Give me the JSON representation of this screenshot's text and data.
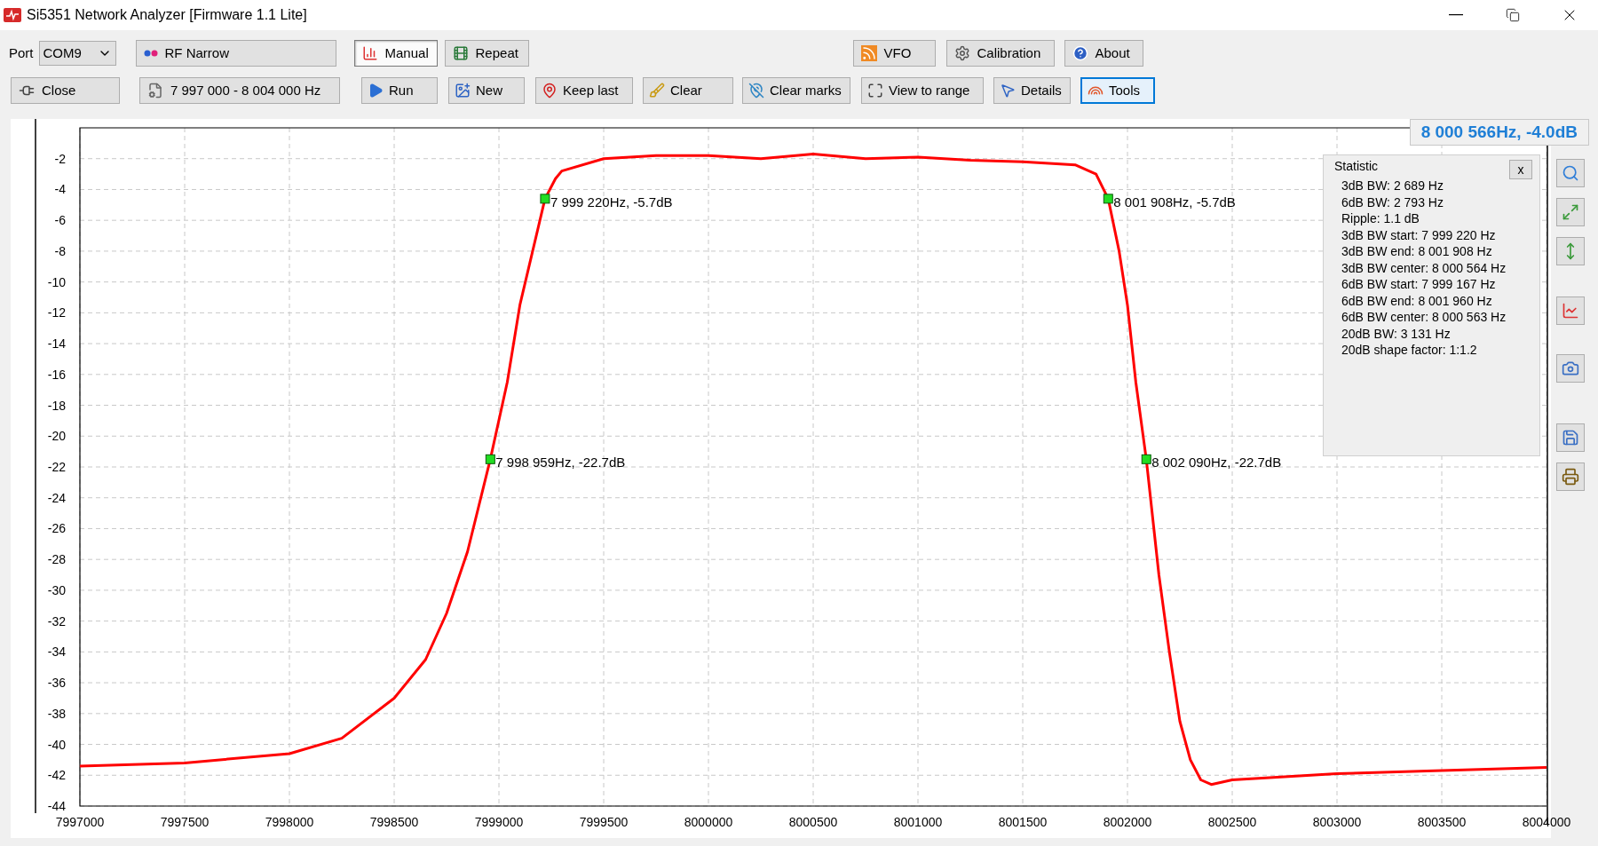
{
  "window": {
    "title": "Si5351 Network Analyzer [Firmware 1.1 Lite]"
  },
  "toolbar": {
    "port_label": "Port",
    "port_value": "COM9",
    "mode": "RF Narrow",
    "range": "7 997 000 - 8 004 000 Hz",
    "close_button": "Close",
    "sweep_modes": [
      {
        "label": "Manual",
        "selected": true
      },
      {
        "label": "Repeat",
        "selected": false
      }
    ],
    "top_buttons": [
      "VFO",
      "Calibration",
      "About"
    ],
    "actions": [
      {
        "label": "Run",
        "focused": false
      },
      {
        "label": "New",
        "focused": false
      },
      {
        "label": "Keep last",
        "focused": false
      },
      {
        "label": "Clear",
        "focused": false
      },
      {
        "label": "Clear marks",
        "focused": false
      },
      {
        "label": "View to range",
        "focused": false
      },
      {
        "label": "Details",
        "focused": false
      },
      {
        "label": "Tools",
        "focused": true
      }
    ]
  },
  "readout": "8 000 566Hz, -4.0dB",
  "statistic": {
    "title": "Statistic",
    "close": "x",
    "lines": [
      "3dB BW: 2 689 Hz",
      "6dB BW: 2 793 Hz",
      "Ripple: 1.1 dB",
      "3dB BW start: 7 999 220 Hz",
      "3dB BW end: 8 001 908 Hz",
      "3dB BW center: 8 000 564 Hz",
      "6dB BW start: 7 999 167 Hz",
      "6dB BW end: 8 001 960 Hz",
      "6dB BW center: 8 000 563 Hz",
      "20dB BW: 3 131 Hz",
      "20dB shape factor: 1:1.2"
    ]
  },
  "chart_data": {
    "type": "line",
    "grid": true,
    "xlim": [
      7997000,
      8004000
    ],
    "ylim": [
      -44,
      0
    ],
    "x": [
      7997000,
      7997500,
      7998000,
      7998250,
      7998500,
      7998650,
      7998750,
      7998850,
      7998959,
      7999040,
      7999100,
      7999220,
      7999270,
      7999300,
      7999500,
      7999750,
      8000000,
      8000250,
      8000500,
      8000750,
      8001000,
      8001250,
      8001500,
      8001750,
      8001850,
      8001908,
      8001960,
      8002000,
      8002040,
      8002090,
      8002150,
      8002200,
      8002250,
      8002300,
      8002350,
      8002400,
      8002500,
      8003000,
      8003500,
      8004000
    ],
    "series": [
      {
        "color": "#ff0000",
        "values": [
          -41.4,
          -41.2,
          -40.6,
          -39.6,
          -37.0,
          -34.5,
          -31.5,
          -27.5,
          -21.5,
          -16.5,
          -11.5,
          -4.6,
          -3.3,
          -2.8,
          -2.0,
          -1.8,
          -1.8,
          -2.0,
          -1.7,
          -2.0,
          -1.9,
          -2.1,
          -2.2,
          -2.4,
          -3.0,
          -4.6,
          -8.0,
          -11.5,
          -16.5,
          -21.5,
          -29.0,
          -34.0,
          -38.5,
          -41.0,
          -42.3,
          -42.6,
          -42.3,
          -41.9,
          -41.7,
          -41.5
        ]
      }
    ],
    "xticks": [
      7997000,
      7997500,
      7998000,
      7998500,
      7999000,
      7999500,
      8000000,
      8000500,
      8001000,
      8001500,
      8002000,
      8002500,
      8003000,
      8003500,
      8004000
    ],
    "yticks": [
      -2,
      -4,
      -6,
      -8,
      -10,
      -12,
      -14,
      -16,
      -18,
      -20,
      -22,
      -24,
      -26,
      -28,
      -30,
      -32,
      -34,
      -36,
      -38,
      -40,
      -42,
      -44
    ],
    "annotations": [
      {
        "x": 7999220,
        "y": -4.6,
        "text": "7 999 220Hz, -5.7dB"
      },
      {
        "x": 8001908,
        "y": -4.6,
        "text": "8 001 908Hz, -5.7dB"
      },
      {
        "x": 7998959,
        "y": -21.5,
        "text": "7 998 959Hz, -22.7dB"
      },
      {
        "x": 8002090,
        "y": -21.5,
        "text": "8 002 090Hz, -22.7dB"
      }
    ]
  }
}
